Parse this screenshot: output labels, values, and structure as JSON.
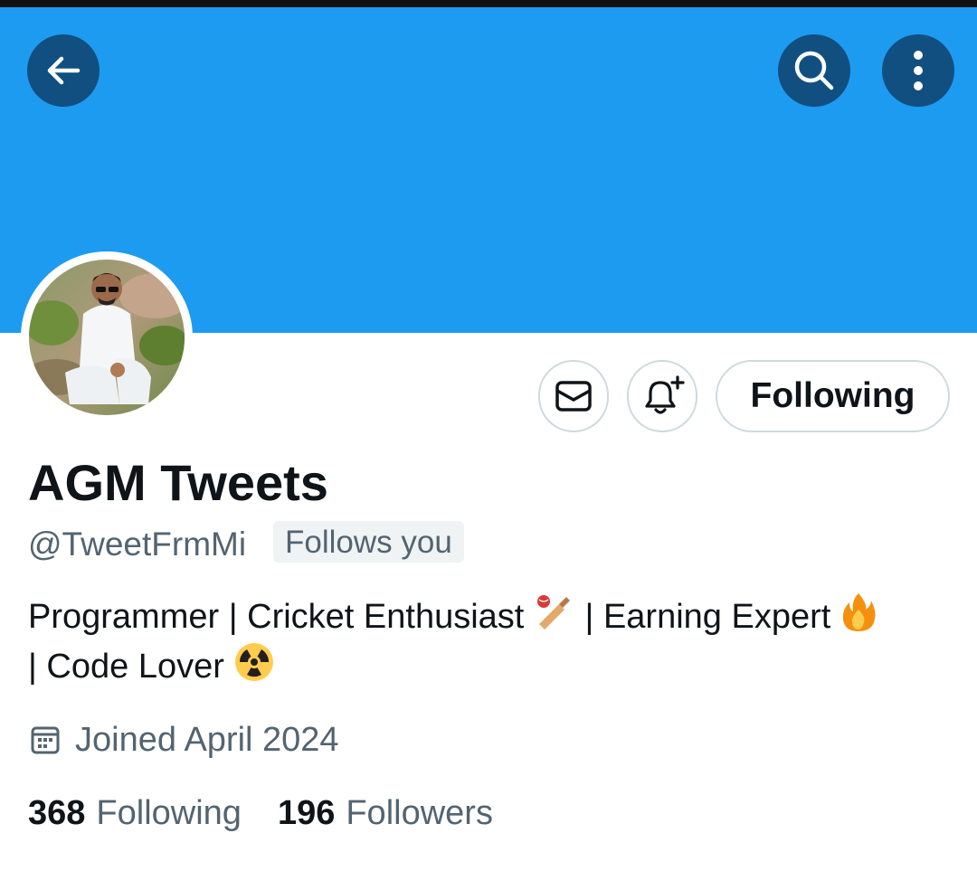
{
  "header": {
    "back_icon": "arrow-left-icon",
    "search_icon": "search-icon",
    "more_icon": "more-vertical-icon",
    "banner_color": "#1d9bf0"
  },
  "actions": {
    "message_icon": "envelope-icon",
    "notify_icon": "bell-plus-icon",
    "following_label": "Following"
  },
  "profile": {
    "display_name": "AGM Tweets",
    "handle": "@TweetFrmMi",
    "follows_you": "Follows you",
    "bio_line1": "Programmer | Cricket Enthusiast",
    "bio_sep": " | ",
    "bio_line1b": "Earning Expert",
    "bio_line2": "| Code Lover",
    "emojis": [
      "cricket-bat-icon",
      "fire-icon",
      "radioactive-icon"
    ],
    "joined_icon": "calendar-icon",
    "joined": "Joined April 2024"
  },
  "stats": {
    "following_count": "368",
    "following_label": "Following",
    "followers_count": "196",
    "followers_label": "Followers"
  }
}
